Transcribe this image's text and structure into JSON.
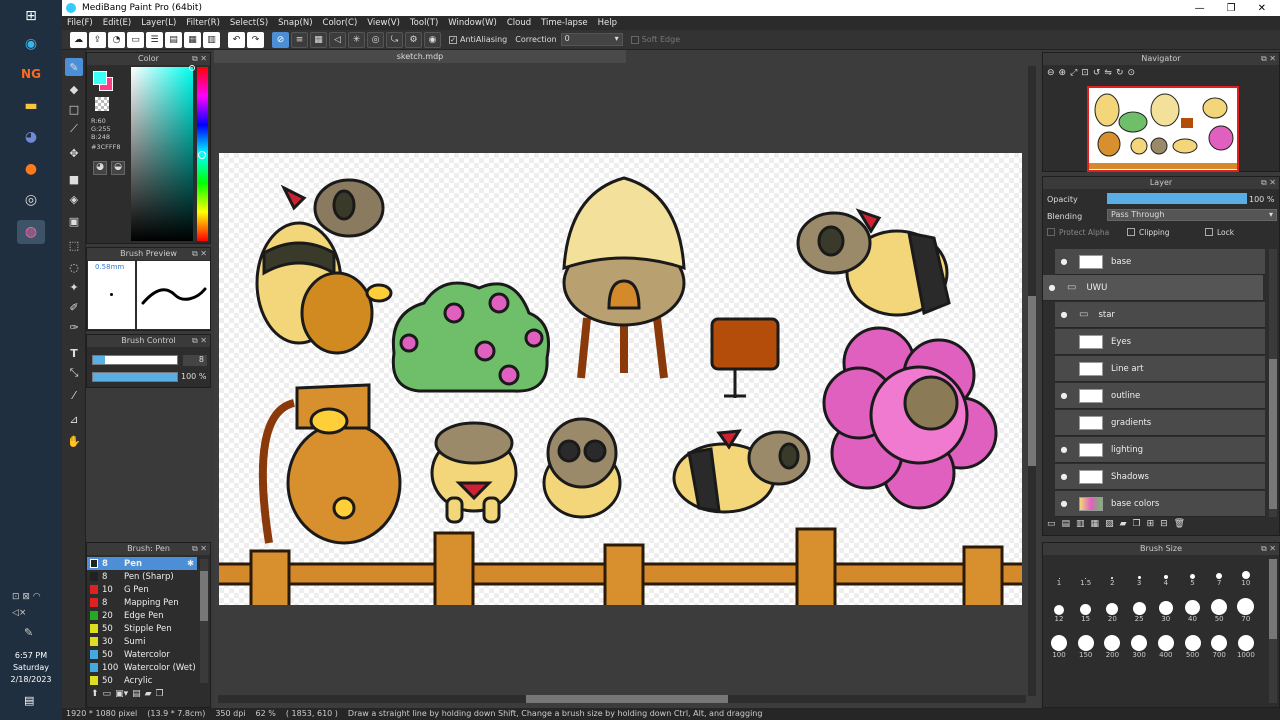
{
  "taskbar": {
    "clock_time": "6:57 PM",
    "clock_day": "Saturday",
    "clock_date": "2/18/2023"
  },
  "window": {
    "title": "MediBang Paint Pro (64bit)"
  },
  "menu": [
    "File(F)",
    "Edit(E)",
    "Layer(L)",
    "Filter(R)",
    "Select(S)",
    "Snap(N)",
    "Color(C)",
    "View(V)",
    "Tool(T)",
    "Window(W)",
    "Cloud",
    "Time-lapse",
    "Help"
  ],
  "toolbar": {
    "antialiasing_label": "AntiAliasing",
    "correction_label": "Correction",
    "correction_value": "0",
    "soft_edge_label": "Soft Edge"
  },
  "color_panel": {
    "title": "Color",
    "r": "R:60",
    "g": "G:255",
    "b": "B:248",
    "hex": "#3CFFF8",
    "main_color": "#3cfff8",
    "sub_color": "#ff3c8c"
  },
  "brush_preview": {
    "title": "Brush Preview",
    "size": "0.58mm"
  },
  "brush_control": {
    "title": "Brush Control",
    "size": "8",
    "opacity": "100 %",
    "opacity_value": 1.0
  },
  "brush_list": {
    "title": "Brush: Pen",
    "items": [
      {
        "size": "8",
        "name": "Pen",
        "color": "#222222"
      },
      {
        "size": "8",
        "name": "Pen (Sharp)",
        "color": "#222222"
      },
      {
        "size": "10",
        "name": "G Pen",
        "color": "#dd2222"
      },
      {
        "size": "8",
        "name": "Mapping Pen",
        "color": "#dd2222"
      },
      {
        "size": "20",
        "name": "Edge Pen",
        "color": "#22aa22"
      },
      {
        "size": "50",
        "name": "Stipple Pen",
        "color": "#dddd22"
      },
      {
        "size": "30",
        "name": "Sumi",
        "color": "#dddd22"
      },
      {
        "size": "50",
        "name": "Watercolor",
        "color": "#44aadd"
      },
      {
        "size": "100",
        "name": "Watercolor (Wet)",
        "color": "#44aadd"
      },
      {
        "size": "50",
        "name": "Acrylic",
        "color": "#dddd22"
      }
    ]
  },
  "canvas": {
    "tab_title": "sketch.mdp"
  },
  "navigator": {
    "title": "Navigator"
  },
  "layer_panel": {
    "title": "Layer",
    "opacity_label": "Opacity",
    "opacity_value": "100 %",
    "opacity_fraction": 1.0,
    "blending_label": "Blending",
    "blending_value": "Pass Through",
    "protect_alpha": "Protect Alpha",
    "clipping": "Clipping",
    "lock": "Lock",
    "layers": [
      {
        "name": "base",
        "folder": false,
        "visible": true
      },
      {
        "name": "UWU",
        "folder": true,
        "visible": true
      },
      {
        "name": "star",
        "folder": true,
        "visible": true
      },
      {
        "name": "Eyes",
        "folder": false,
        "visible": false
      },
      {
        "name": "Line art",
        "folder": false,
        "visible": false
      },
      {
        "name": "outline",
        "folder": false,
        "visible": true
      },
      {
        "name": "gradients",
        "folder": false,
        "visible": false
      },
      {
        "name": "lighting",
        "folder": false,
        "visible": true
      },
      {
        "name": "Shadows",
        "folder": false,
        "visible": true
      },
      {
        "name": "base colors",
        "folder": false,
        "visible": true
      }
    ]
  },
  "brush_size_panel": {
    "title": "Brush Size",
    "sizes": [
      "1",
      "1.5",
      "2",
      "3",
      "4",
      "5",
      "7",
      "10",
      "12",
      "15",
      "20",
      "25",
      "30",
      "40",
      "50",
      "70",
      "100",
      "150",
      "200",
      "300",
      "400",
      "500",
      "700",
      "1000"
    ]
  },
  "status": {
    "dimensions": "1920 * 1080 pixel",
    "physical": "(13.9 * 7.8cm)",
    "dpi": "350 dpi",
    "zoom": "62 %",
    "coords": "( 1853, 610 )",
    "hint": "Draw a straight line by holding down Shift, Change a brush size by holding down Ctrl, Alt, and dragging"
  }
}
